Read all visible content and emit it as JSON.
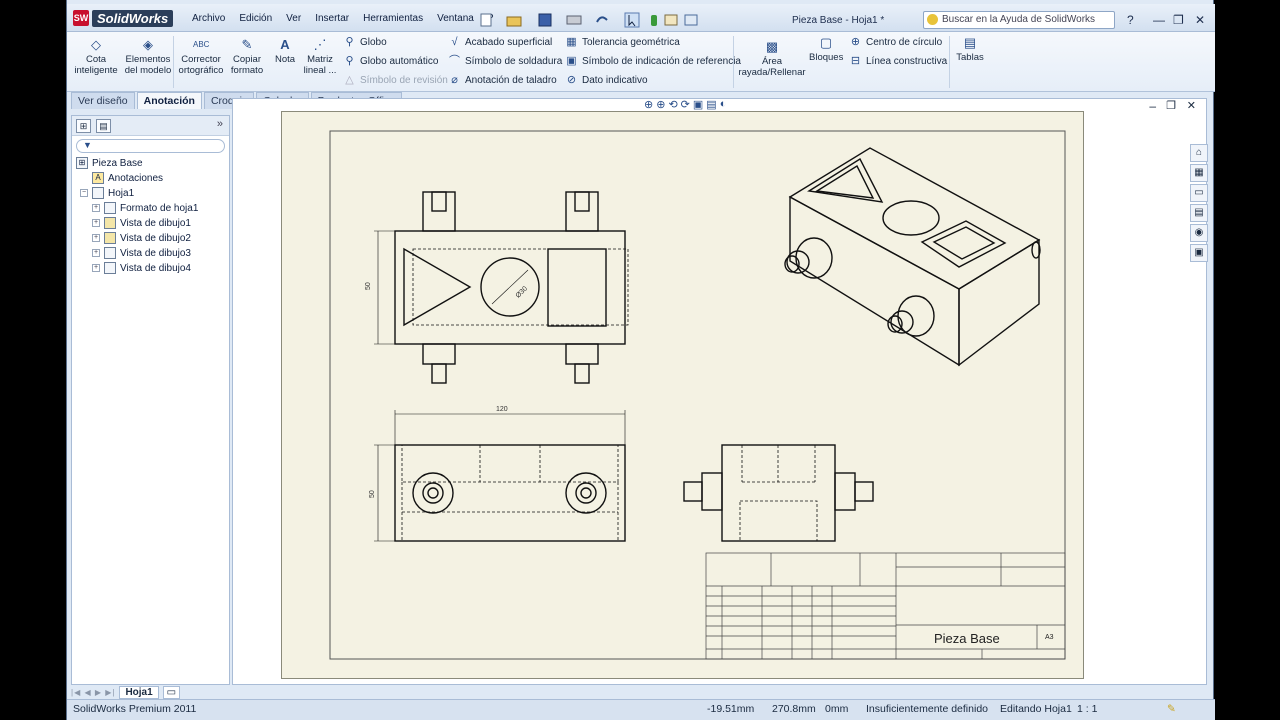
{
  "app": {
    "logo_text": "SolidWorks",
    "logo_badge": "SW"
  },
  "menu": [
    "Archivo",
    "Edición",
    "Ver",
    "Insertar",
    "Herramientas",
    "Ventana",
    "?"
  ],
  "document_title": "Pieza Base - Hoja1 *",
  "search": {
    "placeholder": "Buscar en la Ayuda de SolidWorks"
  },
  "ribbon": {
    "large_buttons": [
      {
        "label": "Cota inteligente",
        "icon": "smart-dimension-icon"
      },
      {
        "label": "Elementos del modelo",
        "icon": "model-items-icon"
      },
      {
        "label": "Corrector ortográfico",
        "icon": "spell-check-icon"
      },
      {
        "label": "Copiar formato",
        "icon": "format-painter-icon"
      },
      {
        "label": "Nota",
        "icon": "note-icon"
      },
      {
        "label": "Matriz lineal ...",
        "icon": "linear-pattern-icon"
      }
    ],
    "col1": [
      {
        "label": "Globo",
        "icon": "balloon-icon",
        "disabled": false
      },
      {
        "label": "Globo automático",
        "icon": "auto-balloon-icon",
        "disabled": false
      },
      {
        "label": "Símbolo de revisión",
        "icon": "revision-symbol-icon",
        "disabled": true
      }
    ],
    "col2": [
      {
        "label": "Acabado superficial",
        "icon": "surface-finish-icon"
      },
      {
        "label": "Símbolo de soldadura",
        "icon": "weld-symbol-icon"
      },
      {
        "label": "Anotación de taladro",
        "icon": "hole-callout-icon"
      }
    ],
    "col3": [
      {
        "label": "Tolerancia geométrica",
        "icon": "geometric-tolerance-icon"
      },
      {
        "label": "Símbolo de indicación de referencia",
        "icon": "datum-feature-icon"
      },
      {
        "label": "Dato indicativo",
        "icon": "datum-target-icon"
      }
    ],
    "area_button": "Área rayada/Rellenar",
    "bloques_button": "Bloques",
    "col4": [
      {
        "label": "Centro de círculo",
        "icon": "center-mark-icon"
      },
      {
        "label": "Línea constructiva",
        "icon": "centerline-icon"
      }
    ],
    "tablas_button": "Tablas"
  },
  "tabs": [
    {
      "label": "Ver diseño",
      "active": false
    },
    {
      "label": "Anotación",
      "active": true
    },
    {
      "label": "Croquis",
      "active": false
    },
    {
      "label": "Calcular",
      "active": false
    },
    {
      "label": "Productos Office",
      "active": false
    }
  ],
  "tree": {
    "root": "Pieza Base",
    "items": [
      {
        "label": "Anotaciones",
        "level": 1,
        "icon": "annotations-icon"
      },
      {
        "label": "Hoja1",
        "level": 1,
        "icon": "sheet-icon"
      },
      {
        "label": "Formato de hoja1",
        "level": 2,
        "icon": "sheet-format-icon"
      },
      {
        "label": "Vista de dibujo1",
        "level": 2,
        "icon": "drawing-view-icon"
      },
      {
        "label": "Vista de dibujo2",
        "level": 2,
        "icon": "drawing-view-icon"
      },
      {
        "label": "Vista de dibujo3",
        "level": 2,
        "icon": "drawing-view-icon"
      },
      {
        "label": "Vista de dibujo4",
        "level": 2,
        "icon": "drawing-view-icon"
      }
    ]
  },
  "drawing": {
    "dim_top_diameter": "Ø30",
    "dim_top_height": "50",
    "dim_front_width": "120",
    "dim_front_height": "50",
    "title_block": {
      "part_name": "Pieza Base",
      "sheet_size": "A3"
    }
  },
  "sheet_tab": "Hoja1",
  "status": {
    "product": "SolidWorks Premium 2011",
    "x": "-19.51mm",
    "y": "270.8mm",
    "z": "0mm",
    "definition": "Insuficientemente definido",
    "editing": "Editando Hoja1",
    "scale": "1 : 1"
  }
}
